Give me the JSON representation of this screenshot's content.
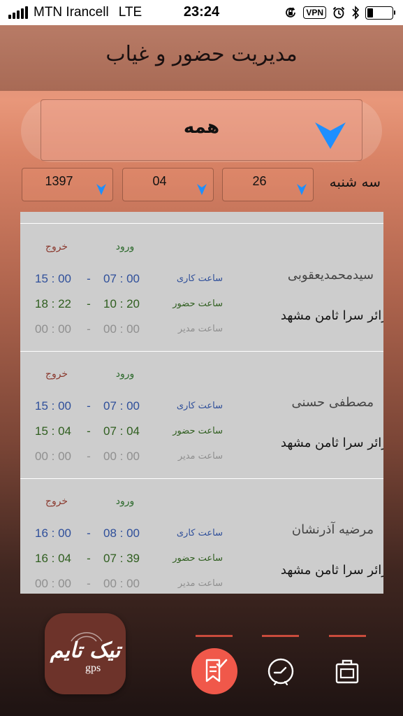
{
  "status_bar": {
    "carrier": "MTN Irancell",
    "network": "LTE",
    "time": "23:24",
    "vpn": "VPN",
    "battery_level": 0.25,
    "icons": [
      "rotation-lock-icon",
      "vpn-badge",
      "alarm-icon",
      "bluetooth-icon",
      "battery-icon"
    ]
  },
  "header": {
    "title": "مدیریت حضور و غیاب"
  },
  "filters": {
    "group": "همه",
    "weekday": "سه شنبه",
    "day": "26",
    "month": "04",
    "year": "1397"
  },
  "list": {
    "entry_header": "ورود",
    "exit_header": "خروج",
    "row_labels": {
      "work": "ساعت کاری",
      "attendance": "ساعت حضور",
      "manager": "ساعت مدیر"
    },
    "dash": "-",
    "employees": [
      {
        "name": "سیدمحمدیعقوبی",
        "org": "زائر سرا ثامن مشهد",
        "work": {
          "in": "07 : 00",
          "out": "15 : 00"
        },
        "attendance": {
          "in": "10 : 20",
          "out": "18 : 22"
        },
        "manager": {
          "in": "00 : 00",
          "out": "00 : 00"
        }
      },
      {
        "name": "مصطفی حسنی",
        "org": "زائر سرا ثامن مشهد",
        "work": {
          "in": "07 : 00",
          "out": "15 : 00"
        },
        "attendance": {
          "in": "07 : 04",
          "out": "15 : 04"
        },
        "manager": {
          "in": "00 : 00",
          "out": "00 : 00"
        }
      },
      {
        "name": "مرضیه آذرنشان",
        "org": "زائر سرا ثامن مشهد",
        "work": {
          "in": "08 : 00",
          "out": "16 : 00"
        },
        "attendance": {
          "in": "07 : 39",
          "out": "16 : 04"
        },
        "manager": {
          "in": "00 : 00",
          "out": "00 : 00"
        }
      }
    ]
  },
  "logo": {
    "text": "تیک تایم",
    "sub": "gps"
  },
  "tabs": [
    {
      "icon": "bookmark-check-icon",
      "active": true
    },
    {
      "icon": "clock-icon",
      "active": false
    },
    {
      "icon": "briefcase-icon",
      "active": false
    }
  ],
  "colors": {
    "accent": "#f0584a",
    "dropdown_arrow": "#1e8fff",
    "work_hours": "#2f4f9a",
    "attendance_hours": "#2f5e1f",
    "manager_hours": "#8f8f8f",
    "exit_header": "#8b3a2f",
    "entry_header": "#2d6a2d"
  }
}
